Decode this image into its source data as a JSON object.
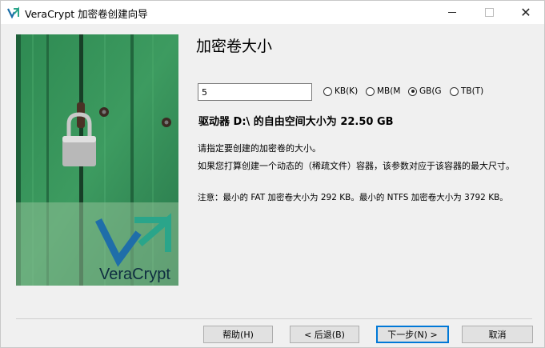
{
  "window": {
    "title": "VeraCrypt 加密卷创建向导"
  },
  "page": {
    "heading": "加密卷大小"
  },
  "size": {
    "value": "5"
  },
  "units": [
    {
      "label": "KB(K)",
      "selected": false
    },
    {
      "label": "MB(M",
      "selected": false
    },
    {
      "label": "GB(G",
      "selected": true
    },
    {
      "label": "TB(T)",
      "selected": false
    }
  ],
  "info": {
    "free_space": "驱动器 D:\\ 的自由空间大小为 22.50 GB",
    "prompt": "请指定要创建的加密卷的大小。",
    "dynamic_note": "如果您打算创建一个动态的（稀疏文件）容器，该参数对应于该容器的最大尺寸。",
    "min_note": "注意：最小的 FAT 加密卷大小为 292 KB。最小的 NTFS 加密卷大小为 3792 KB。"
  },
  "logo": {
    "text": "VeraCrypt"
  },
  "buttons": {
    "help": "帮助(H)",
    "back": "< 后退(B)",
    "next": "下一步(N) >",
    "cancel": "取消"
  }
}
